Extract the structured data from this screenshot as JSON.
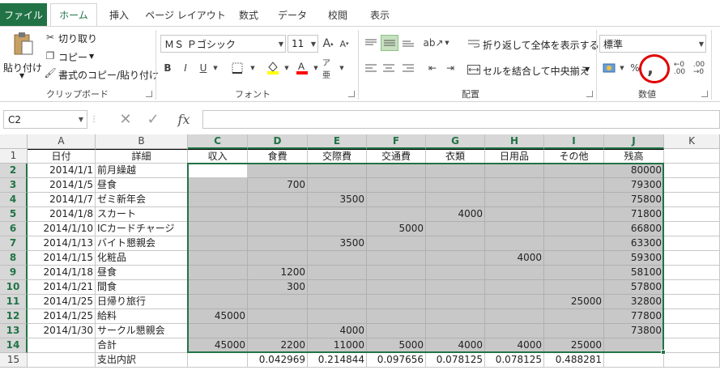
{
  "tabs": [
    "ファイル",
    "ホーム",
    "挿入",
    "ページ レイアウト",
    "数式",
    "データ",
    "校閲",
    "表示"
  ],
  "clipboard": {
    "paste": "貼り付け",
    "cut": "切り取り",
    "copy": "コピー",
    "format_painter": "書式のコピー/貼り付け",
    "group": "クリップボード"
  },
  "font": {
    "name": "ＭＳ Ｐゴシック",
    "size": "11",
    "bold": "B",
    "italic": "I",
    "underline": "U",
    "group": "フォント"
  },
  "alignment": {
    "wrap": "折り返して全体を表示する",
    "merge": "セルを結合して中央揃え",
    "group": "配置"
  },
  "number": {
    "format": "標準",
    "group": "数値",
    "percent": "%",
    "comma": ","
  },
  "formula_bar": {
    "name_box": "C2",
    "fx": "fx",
    "value": ""
  },
  "columns": [
    "A",
    "B",
    "C",
    "D",
    "E",
    "F",
    "G",
    "H",
    "I",
    "J",
    "K"
  ],
  "rows": [
    "1",
    "2",
    "3",
    "4",
    "5",
    "6",
    "7",
    "8",
    "9",
    "10",
    "11",
    "12",
    "13",
    "14",
    "15"
  ],
  "headers": [
    "日付",
    "詳細",
    "収入",
    "食費",
    "交際費",
    "交通費",
    "衣類",
    "日用品",
    "その他",
    "残高"
  ],
  "data": [
    [
      "2014/1/1",
      "前月繰越",
      "",
      "",
      "",
      "",
      "",
      "",
      "",
      "80000"
    ],
    [
      "2014/1/5",
      "昼食",
      "",
      "700",
      "",
      "",
      "",
      "",
      "",
      "79300"
    ],
    [
      "2014/1/7",
      "ゼミ新年会",
      "",
      "",
      "3500",
      "",
      "",
      "",
      "",
      "75800"
    ],
    [
      "2014/1/8",
      "スカート",
      "",
      "",
      "",
      "",
      "4000",
      "",
      "",
      "71800"
    ],
    [
      "2014/1/10",
      "ICカードチャージ",
      "",
      "",
      "",
      "5000",
      "",
      "",
      "",
      "66800"
    ],
    [
      "2014/1/13",
      "バイト懇親会",
      "",
      "",
      "3500",
      "",
      "",
      "",
      "",
      "63300"
    ],
    [
      "2014/1/15",
      "化粧品",
      "",
      "",
      "",
      "",
      "",
      "4000",
      "",
      "59300"
    ],
    [
      "2014/1/18",
      "昼食",
      "",
      "1200",
      "",
      "",
      "",
      "",
      "",
      "58100"
    ],
    [
      "2014/1/21",
      "間食",
      "",
      "300",
      "",
      "",
      "",
      "",
      "",
      "57800"
    ],
    [
      "2014/1/25",
      "日帰り旅行",
      "",
      "",
      "",
      "",
      "",
      "",
      "25000",
      "32800"
    ],
    [
      "2014/1/25",
      "給料",
      "45000",
      "",
      "",
      "",
      "",
      "",
      "",
      "77800"
    ],
    [
      "2014/1/30",
      "サークル懇親会",
      "",
      "",
      "4000",
      "",
      "",
      "",
      "",
      "73800"
    ],
    [
      "",
      "合計",
      "45000",
      "2200",
      "11000",
      "5000",
      "4000",
      "4000",
      "25000",
      ""
    ],
    [
      "",
      "支出内訳",
      "",
      "0.042969",
      "0.214844",
      "0.097656",
      "0.078125",
      "0.078125",
      "0.488281",
      ""
    ]
  ]
}
